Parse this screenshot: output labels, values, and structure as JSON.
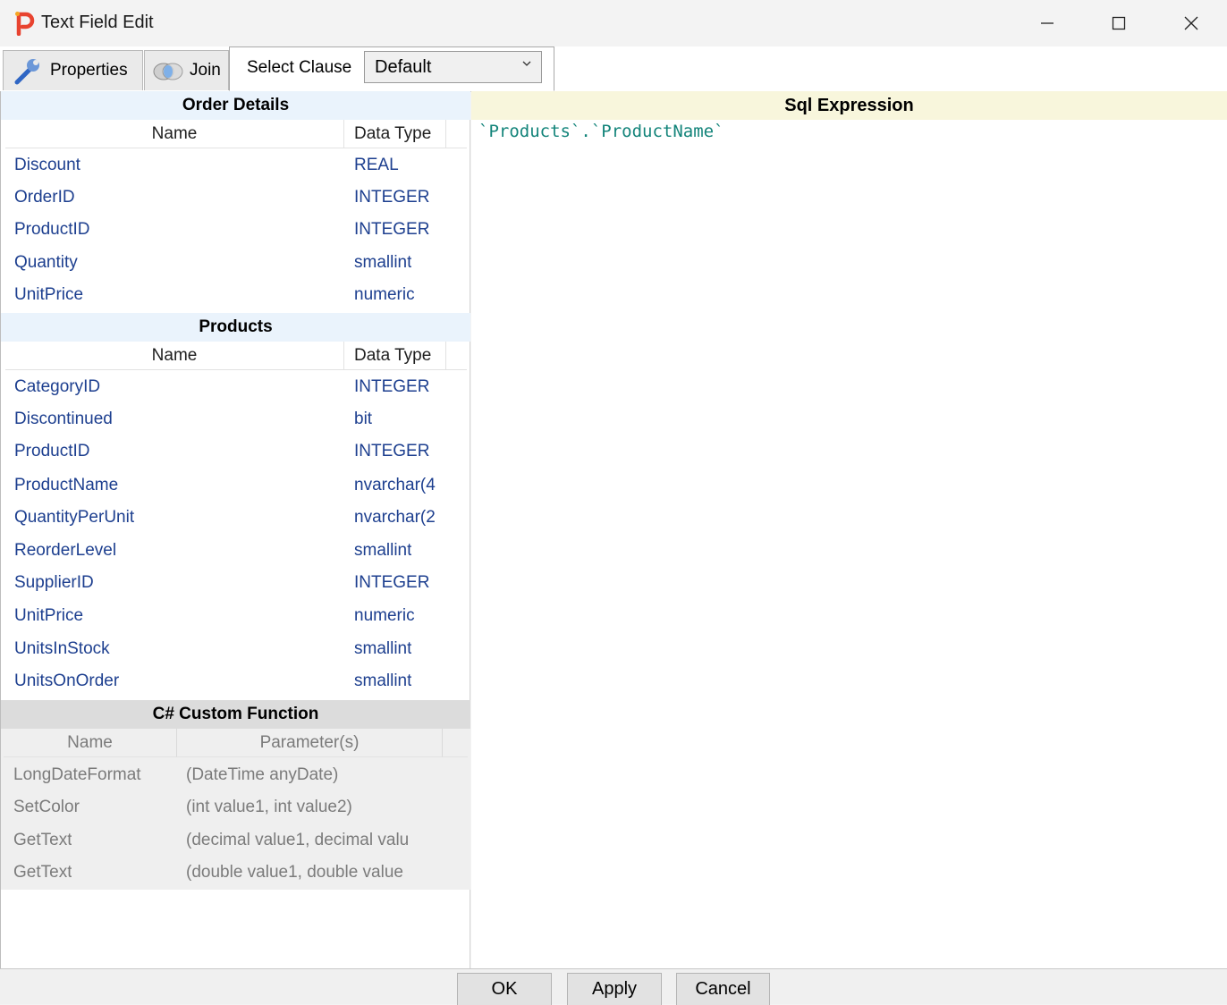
{
  "window": {
    "title": "Text Field Edit"
  },
  "tabs": {
    "properties": "Properties",
    "join": "Join",
    "select_clause": "Select Clause"
  },
  "select_clause_dropdown": {
    "value": "Default"
  },
  "tables": [
    {
      "title": "Order Details",
      "col_name": "Name",
      "col_type": "Data Type",
      "rows": [
        {
          "name": "Discount",
          "type": "REAL"
        },
        {
          "name": "OrderID",
          "type": "INTEGER"
        },
        {
          "name": "ProductID",
          "type": "INTEGER"
        },
        {
          "name": "Quantity",
          "type": "smallint"
        },
        {
          "name": "UnitPrice",
          "type": "numeric"
        }
      ]
    },
    {
      "title": "Products",
      "col_name": "Name",
      "col_type": "Data Type",
      "rows": [
        {
          "name": "CategoryID",
          "type": "INTEGER"
        },
        {
          "name": "Discontinued",
          "type": "bit"
        },
        {
          "name": "ProductID",
          "type": "INTEGER"
        },
        {
          "name": "ProductName",
          "type": "nvarchar(4"
        },
        {
          "name": "QuantityPerUnit",
          "type": "nvarchar(2"
        },
        {
          "name": "ReorderLevel",
          "type": "smallint"
        },
        {
          "name": "SupplierID",
          "type": "INTEGER"
        },
        {
          "name": "UnitPrice",
          "type": "numeric"
        },
        {
          "name": "UnitsInStock",
          "type": "smallint"
        },
        {
          "name": "UnitsOnOrder",
          "type": "smallint"
        }
      ]
    }
  ],
  "custom_functions": {
    "title": "C# Custom Function",
    "col_name": "Name",
    "col_params": "Parameter(s)",
    "rows": [
      {
        "name": "LongDateFormat",
        "params": "(DateTime  anyDate)"
      },
      {
        "name": "SetColor",
        "params": "(int  value1, int  value2)"
      },
      {
        "name": "GetText",
        "params": "(decimal  value1, decimal  valu"
      },
      {
        "name": "GetText",
        "params": "(double  value1, double  value"
      }
    ]
  },
  "sql": {
    "header": "Sql Expression",
    "expression": "`Products`.`ProductName`"
  },
  "buttons": {
    "ok": "OK",
    "apply": "Apply",
    "cancel": "Cancel"
  },
  "colors": {
    "section_head_bg": "#eaf3fc",
    "function_head_bg": "#dcdcdc",
    "function_area_bg": "#efefef",
    "sql_head_bg": "#f8f6dc",
    "sql_text": "#13847a",
    "field_text": "#1d3f8f"
  }
}
